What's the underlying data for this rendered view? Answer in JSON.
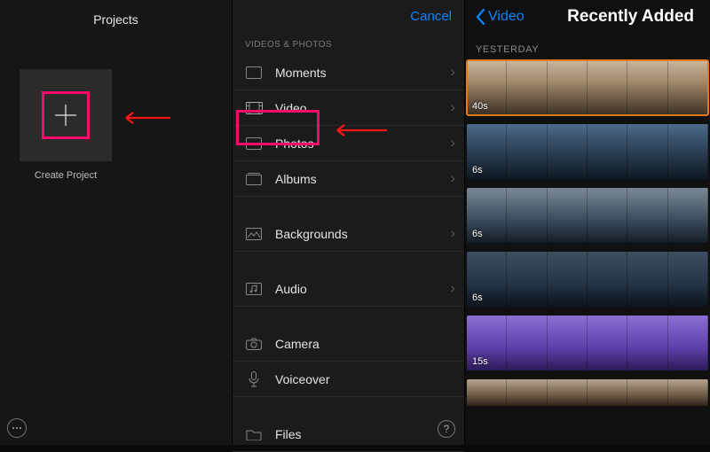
{
  "left": {
    "title": "Projects",
    "create_label": "Create Project"
  },
  "mid": {
    "cancel": "Cancel",
    "section": "VIDEOS & PHOTOS",
    "items": [
      {
        "label": "Moments"
      },
      {
        "label": "Video"
      },
      {
        "label": "Photos"
      },
      {
        "label": "Albums"
      },
      {
        "label": "Backgrounds"
      },
      {
        "label": "Audio"
      },
      {
        "label": "Camera"
      },
      {
        "label": "Voiceover"
      },
      {
        "label": "Files"
      }
    ]
  },
  "right": {
    "back": "Video",
    "title": "Recently Added",
    "section": "YESTERDAY",
    "clips": [
      {
        "duration": "40s"
      },
      {
        "duration": "6s"
      },
      {
        "duration": "6s"
      },
      {
        "duration": "6s"
      },
      {
        "duration": "15s"
      },
      {
        "duration": ""
      }
    ]
  }
}
